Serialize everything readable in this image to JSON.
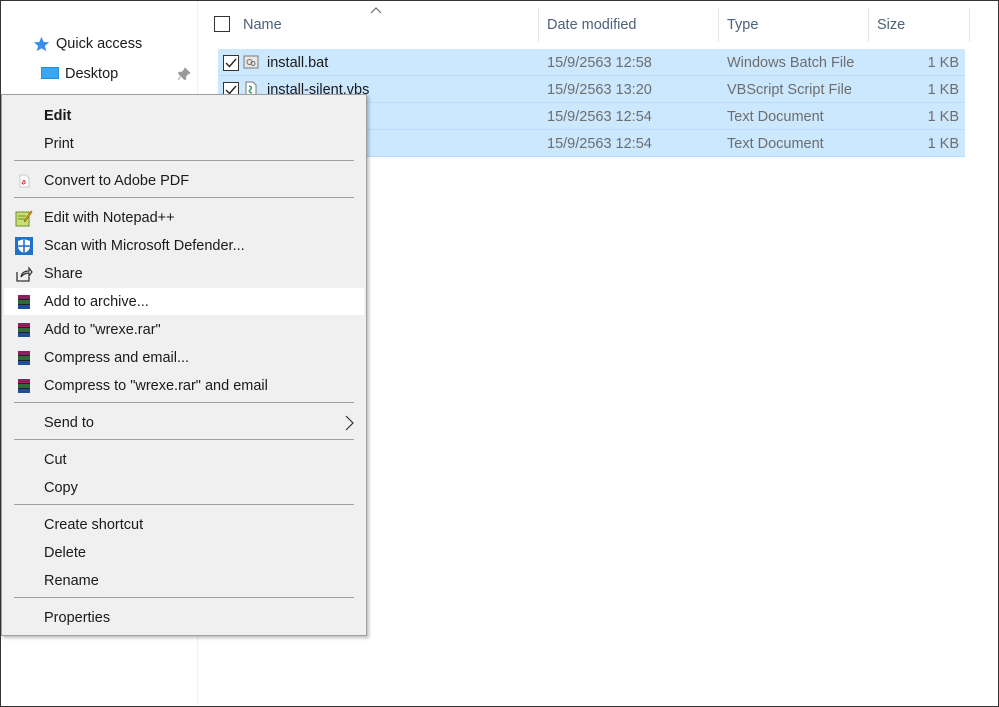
{
  "nav": {
    "quick_access": "Quick access",
    "desktop": "Desktop"
  },
  "columns": {
    "name": "Name",
    "date": "Date modified",
    "type": "Type",
    "size": "Size"
  },
  "files": [
    {
      "name": "install.bat",
      "date": "15/9/2563 12:58",
      "type": "Windows Batch File",
      "size": "1 KB",
      "icon": "batch-file-icon"
    },
    {
      "name": "install-silent.vbs",
      "date": "15/9/2563 13:20",
      "type": "VBScript Script File",
      "size": "1 KB",
      "icon": "vbscript-file-icon"
    },
    {
      "name": "",
      "date": "15/9/2563 12:54",
      "type": "Text Document",
      "size": "1 KB",
      "icon": ""
    },
    {
      "name": "",
      "date": "15/9/2563 12:54",
      "type": "Text Document",
      "size": "1 KB",
      "icon": ""
    }
  ],
  "context_menu": {
    "edit": "Edit",
    "print": "Print",
    "convert_pdf": "Convert to Adobe PDF",
    "edit_notepad": "Edit with Notepad++",
    "scan_defender": "Scan with Microsoft Defender...",
    "share": "Share",
    "add_archive": "Add to archive...",
    "add_rar": "Add to \"wrexe.rar\"",
    "compress_email": "Compress and email...",
    "compress_rar_email": "Compress to \"wrexe.rar\" and email",
    "send_to": "Send to",
    "cut": "Cut",
    "copy": "Copy",
    "create_shortcut": "Create shortcut",
    "delete": "Delete",
    "rename": "Rename",
    "properties": "Properties"
  },
  "colors": {
    "selection": "#cce8ff",
    "menu_bg": "#f0f0f0",
    "hover": "#ffffff",
    "header_text": "#4c607a"
  }
}
